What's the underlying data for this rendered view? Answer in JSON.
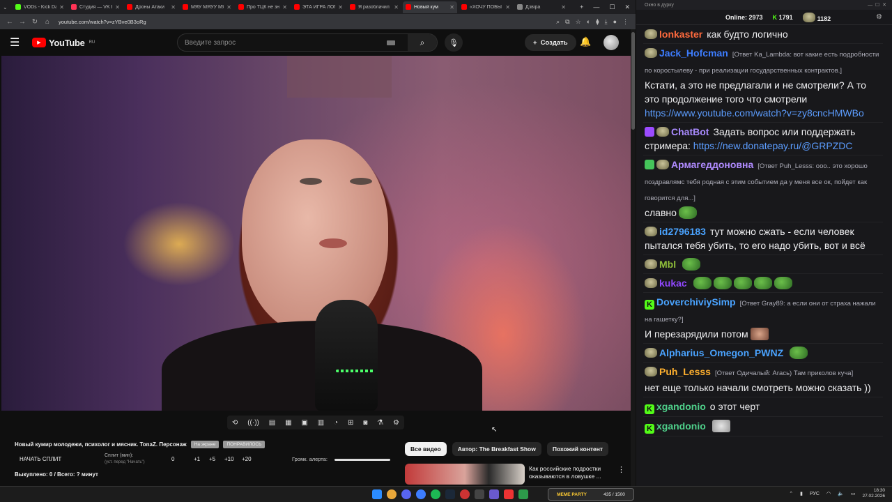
{
  "browser": {
    "tabs": [
      {
        "label": "VODs - Kick Da",
        "color": "#53fc18",
        "active": false
      },
      {
        "label": "Студия — VK В",
        "color": "#ff3355",
        "active": false
      },
      {
        "label": "Дроны Атаки",
        "color": "#ff0000",
        "active": false
      },
      {
        "label": "МЯУ МЯУУ МЯ",
        "color": "#ff0000",
        "active": false
      },
      {
        "label": "Про ТЦК не зн",
        "color": "#ff0000",
        "active": false
      },
      {
        "label": "ЭТА ИГРА ЛОМ",
        "color": "#ff0000",
        "active": false
      },
      {
        "label": "Я разоблачил",
        "color": "#ff0000",
        "active": false
      },
      {
        "label": "Новый кум",
        "color": "#ff0000",
        "active": true
      },
      {
        "label": "«ХОЧУ ПОБЫ",
        "color": "#ff0000",
        "active": false
      },
      {
        "label": "Дзвіра",
        "color": "#888888",
        "active": false
      }
    ],
    "url": "youtube.com/watch?v=zYBve0B3oRg"
  },
  "youtube": {
    "logo": "YouTube",
    "region": "RU",
    "search_placeholder": "Введите запрос",
    "create_label": "Создать"
  },
  "video": {
    "title": "Новый кумир молодежи, психолог и мясник. TonaZ. Персонаж",
    "pill1": "На экране",
    "pill2": "ПОНРАВИЛОСЬ"
  },
  "split": {
    "start_label": "НАЧАТЬ СПЛИТ",
    "min_label": "Сплит (мин):",
    "min_sub": "(уст. перед \"Начать\")",
    "value": "0",
    "inc": [
      "+1",
      "+5",
      "+10",
      "+20"
    ],
    "alert_label": "Громк. алерта:",
    "alert_volume": 1.0,
    "paid_label": "Выкуплено: 0 / Всего: ? минут"
  },
  "chips": [
    "Все видео",
    "Автор: The Breakfast Show",
    "Похожий контент"
  ],
  "recommendation": {
    "title_line1": "Как российские подростки",
    "title_line2": "оказываются в ловушке ..."
  },
  "chat": {
    "window_title": "Окно в дурку",
    "online_label": "Online:",
    "online_value": "2973",
    "kick_count": "1791",
    "pepe_count": "1182",
    "messages": [
      {
        "nick": "lonkaster",
        "nick_color": "#ff6a3d",
        "badge": "pepe",
        "reply": "",
        "text": "как будто логично",
        "link": ""
      },
      {
        "nick": "Jack_Hofcman",
        "nick_color": "#3d7dff",
        "badge": "pepe",
        "reply": "[Ответ Ka_Lambda: вот какие есть подробности по коростылеву - при реализации государственных контрактов.]",
        "text": "Кстати, а это не предлагали и не смотрели? А то это продолжение того что смотрели",
        "link": "https://www.youtube.com/watch?v=zy8cncHMWBo"
      },
      {
        "nick": "ChatBot",
        "nick_color": "#a98bff",
        "badge": "bot",
        "reply": "",
        "text": "Задать вопрос или поддержать стримера:",
        "link": "https://new.donatepay.ru/@GRPZDC"
      },
      {
        "nick": "Армагеддоновна",
        "nick_color": "#b08bff",
        "badge": "shield",
        "reply": "[Ответ Puh_Lesss: ооо.. это хорошо поздравлямс тебя родная с этим событием да у меня все ок, пойдет как говорится для...]",
        "text": "славно",
        "link": ""
      },
      {
        "nick": "id2796183",
        "nick_color": "#4aa3ff",
        "badge": "pepe",
        "reply": "",
        "text": "тут можно сжать - если человек пытался тебя убить, то его надо убить, вот и всё",
        "link": ""
      },
      {
        "nick": "Mbl",
        "nick_color": "#8fbf3a",
        "badge": "pepe",
        "reply": "",
        "text": "",
        "link": ""
      },
      {
        "nick": "kukac",
        "nick_color": "#9147ff",
        "badge": "pepe",
        "reply": "",
        "text": "",
        "link": ""
      },
      {
        "nick": "DoverchiviySimp",
        "nick_color": "#4aa3ff",
        "badge": "k",
        "reply": "[Ответ Gray89: а если они от страха нажали на гашетку?]",
        "text": "И перезарядили потом",
        "link": ""
      },
      {
        "nick": "Alpharius_Omegon_PWNZ",
        "nick_color": "#4aa3ff",
        "badge": "pepe",
        "reply": "",
        "text": "",
        "link": ""
      },
      {
        "nick": "Puh_Lesss",
        "nick_color": "#ffb02e",
        "badge": "pepe",
        "reply": "[Ответ Одичалый: Агась) Там приколов куча]",
        "text": "нет еще только начали смотреть можно сказать ))",
        "link": ""
      },
      {
        "nick": "xgandonio",
        "nick_color": "#4fd18b",
        "badge": "k",
        "reply": "",
        "text": "о этот черт",
        "link": ""
      },
      {
        "nick": "xgandonio",
        "nick_color": "#4fd18b",
        "badge": "k",
        "reply": "",
        "text": "",
        "link": ""
      }
    ]
  },
  "taskbar": {
    "meme_label": "MEME PARTY",
    "meme_counter": "435 / 1500",
    "lang": "РУС",
    "time": "18:30",
    "date": "27.02.2026"
  }
}
